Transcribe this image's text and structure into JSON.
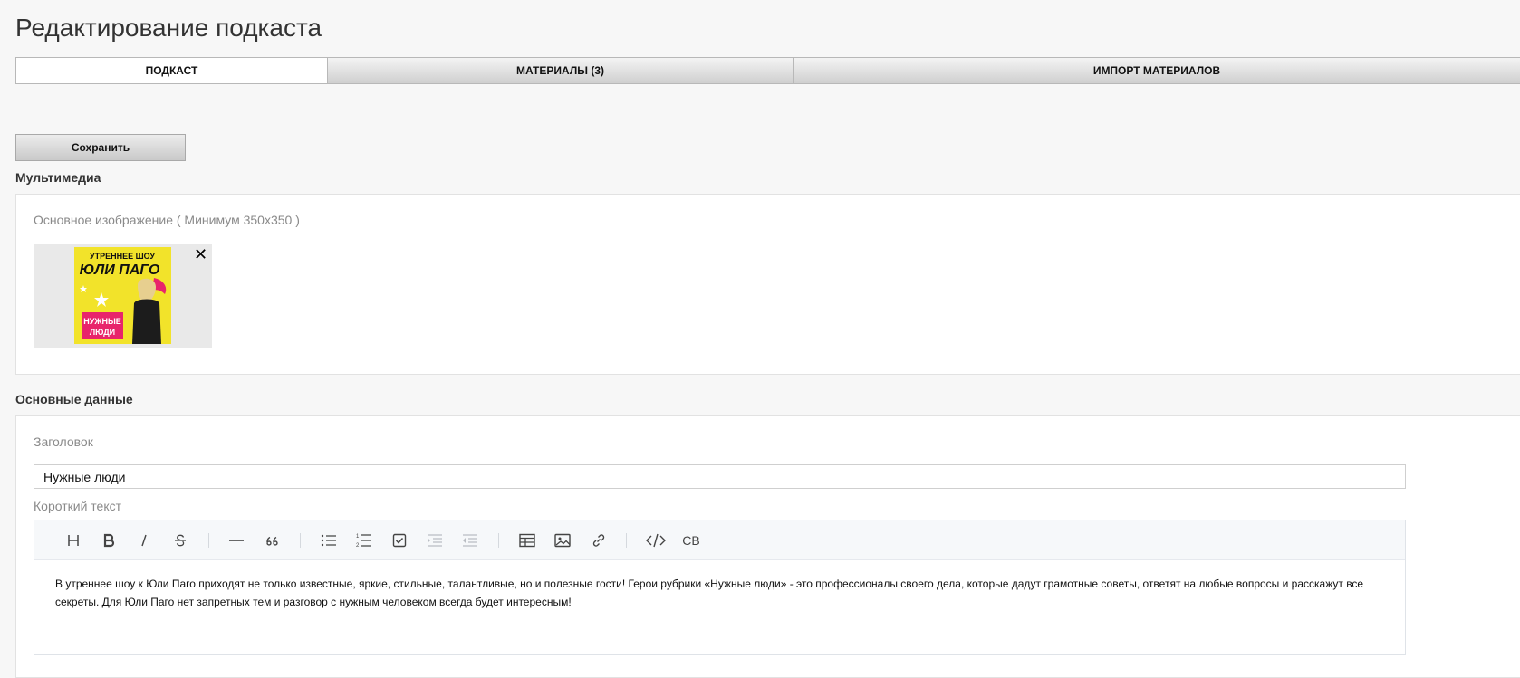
{
  "page": {
    "title": "Редактирование подкаста"
  },
  "tabs": [
    {
      "label": "ПОДКАСТ",
      "active": true
    },
    {
      "label": "МАТЕРИАЛЫ (3)",
      "active": false
    },
    {
      "label": "ИМПОРТ МАТЕРИАЛОВ",
      "active": false
    }
  ],
  "actions": {
    "save_label": "Сохранить"
  },
  "multimedia": {
    "heading": "Мультимедиа",
    "main_image_label": "Основное изображение ( Минимум 350x350 )",
    "thumbnail": {
      "line1": "УТРЕННЕЕ ШОУ",
      "line2": "ЮЛИ ПАГО",
      "badge_line1": "НУЖНЫЕ",
      "badge_line2": "ЛЮДИ",
      "bg_color": "#f2e32a",
      "badge_color": "#e8246b"
    },
    "remove_symbol": "✕"
  },
  "main_data": {
    "heading": "Основные данные",
    "title_label": "Заголовок",
    "title_value": "Нужные люди",
    "short_text_label": "Короткий текст",
    "short_text_value": "В утреннее шоу к Юли Паго приходят не только известные, яркие, стильные, талантливые, но и полезные гости! Герои рубрики «Нужные люди» - это профессионалы своего дела, которые дадут грамотные советы, ответят на любые вопросы и расскажут все секреты. Для Юли Паго нет запретных тем и разговор с нужным человеком всегда будет интересным!"
  },
  "editor_toolbar": {
    "tools": [
      {
        "name": "heading-icon",
        "glyph": "H",
        "enabled": true
      },
      {
        "name": "bold-icon",
        "glyph": "B",
        "enabled": true
      },
      {
        "name": "italic-icon",
        "glyph": "I",
        "enabled": true
      },
      {
        "name": "strikethrough-icon",
        "glyph": "S",
        "enabled": true
      },
      {
        "name": "horizontal-rule-icon",
        "glyph": "—",
        "enabled": true
      },
      {
        "name": "quote-icon",
        "glyph": "66",
        "enabled": true
      },
      {
        "name": "bullet-list-icon",
        "glyph": "",
        "enabled": true
      },
      {
        "name": "ordered-list-icon",
        "glyph": "",
        "enabled": true
      },
      {
        "name": "task-list-icon",
        "glyph": "",
        "enabled": true
      },
      {
        "name": "indent-icon",
        "glyph": "",
        "enabled": false
      },
      {
        "name": "outdent-icon",
        "glyph": "",
        "enabled": false
      },
      {
        "name": "table-icon",
        "glyph": "",
        "enabled": true
      },
      {
        "name": "image-icon",
        "glyph": "",
        "enabled": true
      },
      {
        "name": "link-icon",
        "glyph": "",
        "enabled": true
      },
      {
        "name": "code-icon",
        "glyph": "</>",
        "enabled": true
      },
      {
        "name": "code-block-icon",
        "glyph": "CB",
        "enabled": true
      }
    ]
  }
}
